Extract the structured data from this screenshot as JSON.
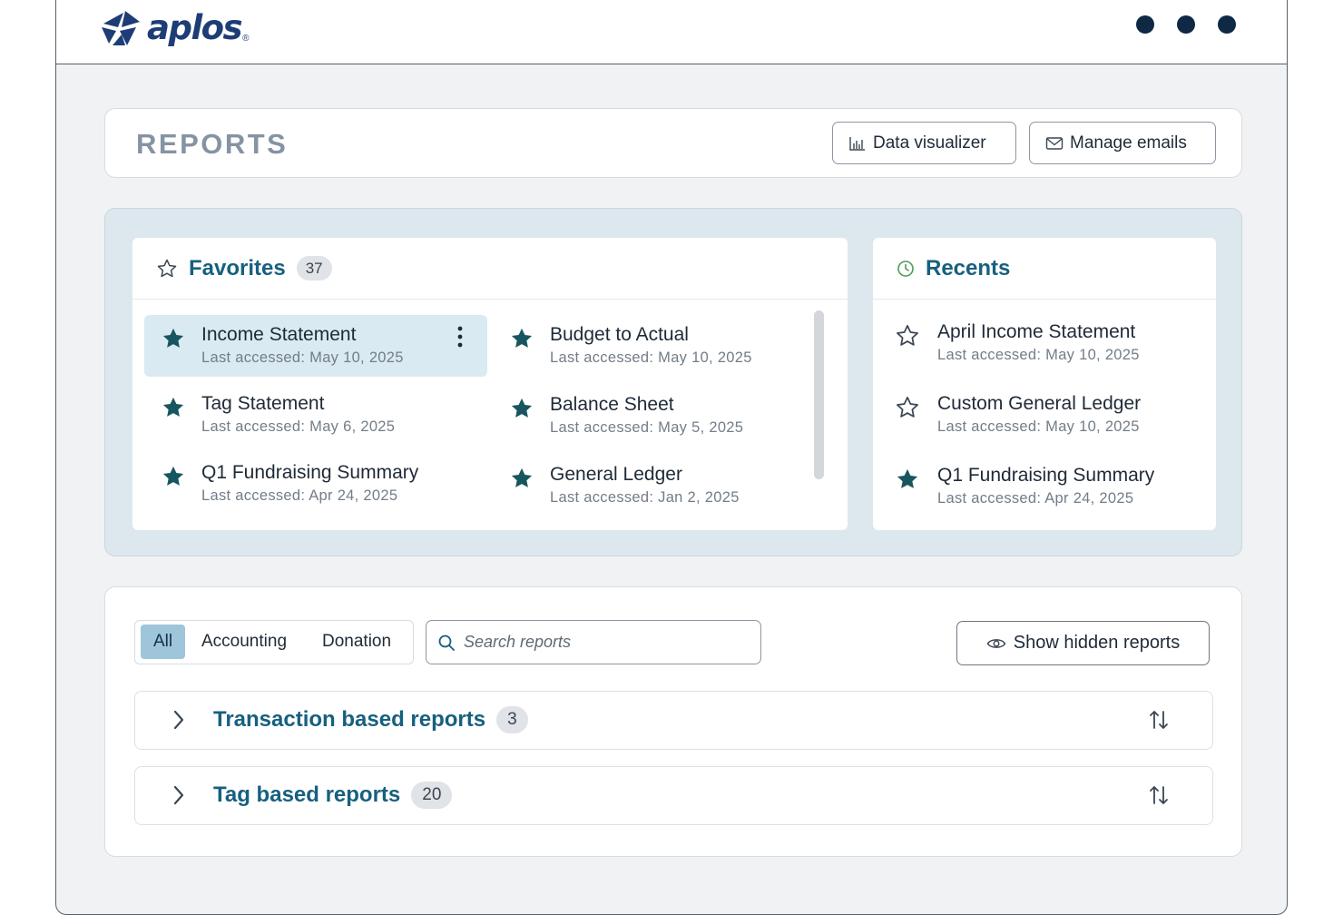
{
  "brand": {
    "name": "aplos",
    "mark": "®"
  },
  "header": {
    "title": "REPORTS",
    "buttons": {
      "data_visualizer": "Data visualizer",
      "manage_emails": "Manage emails"
    }
  },
  "favorites": {
    "title": "Favorites",
    "count": "37",
    "items": [
      {
        "name": "Income Statement",
        "last": "Last accessed: May 10, 2025"
      },
      {
        "name": "Budget to Actual",
        "last": "Last accessed: May 10, 2025"
      },
      {
        "name": "Tag Statement",
        "last": "Last accessed: May 6, 2025"
      },
      {
        "name": "Balance Sheet",
        "last": "Last accessed: May 5, 2025"
      },
      {
        "name": "Q1 Fundraising Summary",
        "last": "Last accessed: Apr 24, 2025"
      },
      {
        "name": "General Ledger",
        "last": "Last accessed: Jan 2, 2025"
      }
    ]
  },
  "recents": {
    "title": "Recents",
    "items": [
      {
        "name": "April Income Statement",
        "last": "Last accessed: May 10, 2025",
        "favorited": false
      },
      {
        "name": "Custom General Ledger",
        "last": "Last accessed: May 10, 2025",
        "favorited": false
      },
      {
        "name": "Q1 Fundraising Summary",
        "last": "Last accessed: Apr 24, 2025",
        "favorited": true
      }
    ]
  },
  "filters": {
    "tabs": [
      "All",
      "Accounting",
      "Donation"
    ],
    "active": "All"
  },
  "search": {
    "placeholder": "Search reports"
  },
  "show_hidden_label": "Show hidden reports",
  "groups": [
    {
      "title": "Transaction based reports",
      "count": "3"
    },
    {
      "title": "Tag based reports",
      "count": "20"
    }
  ],
  "colors": {
    "accent": "#17607f",
    "star": "#17565f",
    "brand": "#1e3d76",
    "panel": "#dde8ee",
    "selected": "#d9eaf3"
  }
}
